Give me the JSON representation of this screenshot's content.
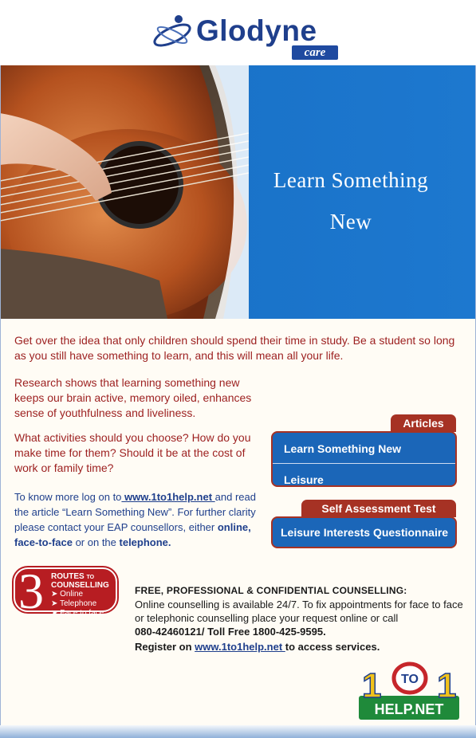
{
  "brand": {
    "name": "Glodyne",
    "sub": "care"
  },
  "hero": {
    "title_line1": "Learn Something",
    "title_line2": "New"
  },
  "content": {
    "intro": "Get over the idea that only children should spend their time in study. Be a student so long as you still have something to learn, and this will mean all your life.",
    "research": "Research shows that learning something new keeps our brain active, memory oiled, enhances sense  of youthfulness and liveliness.",
    "activities": "What activities should you choose? How do you make time for them? Should it be at the cost of work or family time?",
    "know_prefix": "To know more log on to",
    "know_link": " www.1to1help.net ",
    "know_mid": " and read the article “Learn Something New”. For further clarity please contact your EAP counsellors, either ",
    "know_online": "online, face-to-face",
    "know_or": " or on the ",
    "know_telephone": "telephone.",
    "know_end": ""
  },
  "articles": {
    "tab": "Articles",
    "items": [
      "Learn Something New",
      "Leisure"
    ]
  },
  "self_assessment": {
    "tab": "Self Assessment Test",
    "items": [
      "Leisure Interests Questionnaire"
    ]
  },
  "routes": {
    "number": "3",
    "title_routes": "ROUTES",
    "title_to": "TO",
    "title_counselling": "COUNSELLING",
    "items": [
      "➤ Online",
      "➤ Telephone",
      "➤ Face to face"
    ]
  },
  "counselling": {
    "heading": "FREE, PROFESSIONAL & CONFIDENTIAL COUNSELLING:",
    "text": "Online counselling is available 24/7. To fix appointments for face to face or telephonic counselling place your request online or call",
    "phone": "080-42460121/ Toll Free 1800-425-9595.",
    "register_prefix": "Register on ",
    "register_link": "www.1to1help.net ",
    "register_suffix": " to access services."
  },
  "footer_logo": {
    "top": "1 TO 1",
    "bottom": "HELP.NET"
  },
  "colors": {
    "brand_blue": "#1f3f8c",
    "hero_blue": "#1a73c9",
    "accent_red": "#a63224",
    "text_red": "#9c1f1f",
    "panel_blue": "#1b66b8"
  }
}
